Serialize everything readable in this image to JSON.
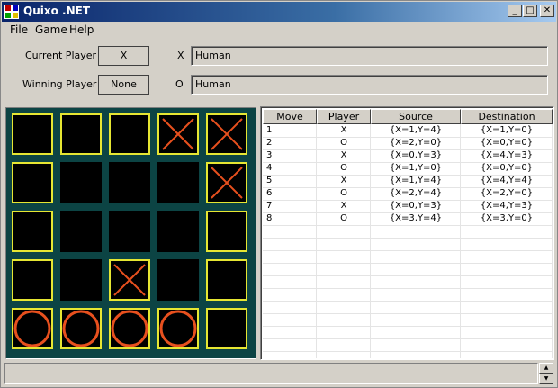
{
  "window": {
    "title": "Quixo .NET",
    "minimize": "_",
    "maximize": "□",
    "close": "✕"
  },
  "menu": {
    "file": "File",
    "game": "Game",
    "help": "Help"
  },
  "info": {
    "current_player_label": "Current Player",
    "current_player_value": "X",
    "winning_player_label": "Winning Player",
    "winning_player_value": "None",
    "x_label": "X",
    "x_player": "Human",
    "o_label": "O",
    "o_player": "Human"
  },
  "board": {
    "rows": [
      [
        "empty",
        "empty",
        "empty",
        "X",
        "X"
      ],
      [
        "empty",
        "blank",
        "blank",
        "blank",
        "X"
      ],
      [
        "empty",
        "blank",
        "blank",
        "blank",
        "empty"
      ],
      [
        "empty",
        "blank",
        "X",
        "blank",
        "empty"
      ],
      [
        "O",
        "O",
        "O",
        "O",
        "empty"
      ]
    ],
    "colors": {
      "background": "#0c4444",
      "highlight": "#e6e632",
      "mark": "#e8501e"
    }
  },
  "moves": {
    "columns": [
      "Move",
      "Player",
      "Source",
      "Destination"
    ],
    "rows": [
      [
        "1",
        "X",
        "{X=1,Y=4}",
        "{X=1,Y=0}"
      ],
      [
        "2",
        "O",
        "{X=2,Y=0}",
        "{X=0,Y=0}"
      ],
      [
        "3",
        "X",
        "{X=0,Y=3}",
        "{X=4,Y=3}"
      ],
      [
        "4",
        "O",
        "{X=1,Y=0}",
        "{X=0,Y=0}"
      ],
      [
        "5",
        "X",
        "{X=1,Y=4}",
        "{X=4,Y=4}"
      ],
      [
        "6",
        "O",
        "{X=2,Y=4}",
        "{X=2,Y=0}"
      ],
      [
        "7",
        "X",
        "{X=0,Y=3}",
        "{X=4,Y=3}"
      ],
      [
        "8",
        "O",
        "{X=3,Y=4}",
        "{X=3,Y=0}"
      ]
    ]
  },
  "status": {
    "text": ""
  }
}
